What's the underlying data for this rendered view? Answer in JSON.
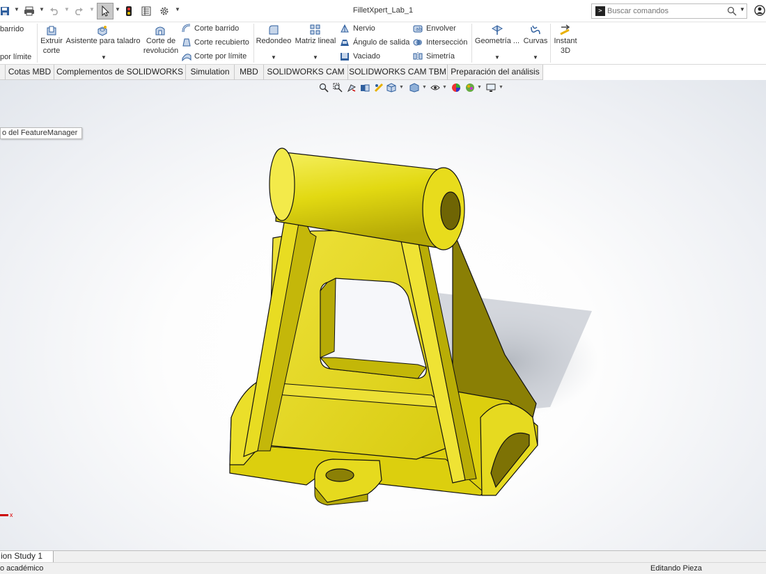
{
  "window": {
    "title": "FilletXpert_Lab_1"
  },
  "search": {
    "placeholder": "Buscar comandos",
    "prompt_glyph": ">"
  },
  "ribbon": {
    "left_group": {
      "top_label": "barrido",
      "bottom_label": "por límite"
    },
    "extrude_cut": {
      "line1": "Extruir",
      "line2": "corte"
    },
    "hole_wizard": {
      "label": "Asistente para taladro"
    },
    "revolve_cut": {
      "line1": "Corte de",
      "line2": "revolución"
    },
    "cut_stack": [
      "Corte barrido",
      "Corte recubierto",
      "Corte por límite"
    ],
    "fillet": {
      "label": "Redondeo"
    },
    "linear_pattern": {
      "label": "Matriz lineal"
    },
    "feature_stack": [
      "Nervio",
      "Ángulo de salida",
      "Vaciado"
    ],
    "feature_stack2": [
      "Envolver",
      "Intersección",
      "Simetría"
    ],
    "ref_geometry": {
      "label": "Geometría ..."
    },
    "curves": {
      "label": "Curvas"
    },
    "instant3d": {
      "line1": "Instant",
      "line2": "3D"
    }
  },
  "tabs": [
    "Cotas MBD",
    "Complementos de SOLIDWORKS",
    "Simulation",
    "MBD",
    "SOLIDWORKS CAM",
    "SOLIDWORKS CAM TBM",
    "Preparación del análisis"
  ],
  "viewport": {
    "featuremanager_tip": "o del FeatureManager",
    "axis_label": "x",
    "model_color": "#e0d800"
  },
  "bottom": {
    "sheet_tab": "ion Study 1",
    "status_left": "o académico",
    "status_right": "Editando Pieza"
  },
  "colors": {
    "accent_blue": "#2f5f9e",
    "part_yellow": "#e0d800",
    "part_edge": "#222222"
  }
}
